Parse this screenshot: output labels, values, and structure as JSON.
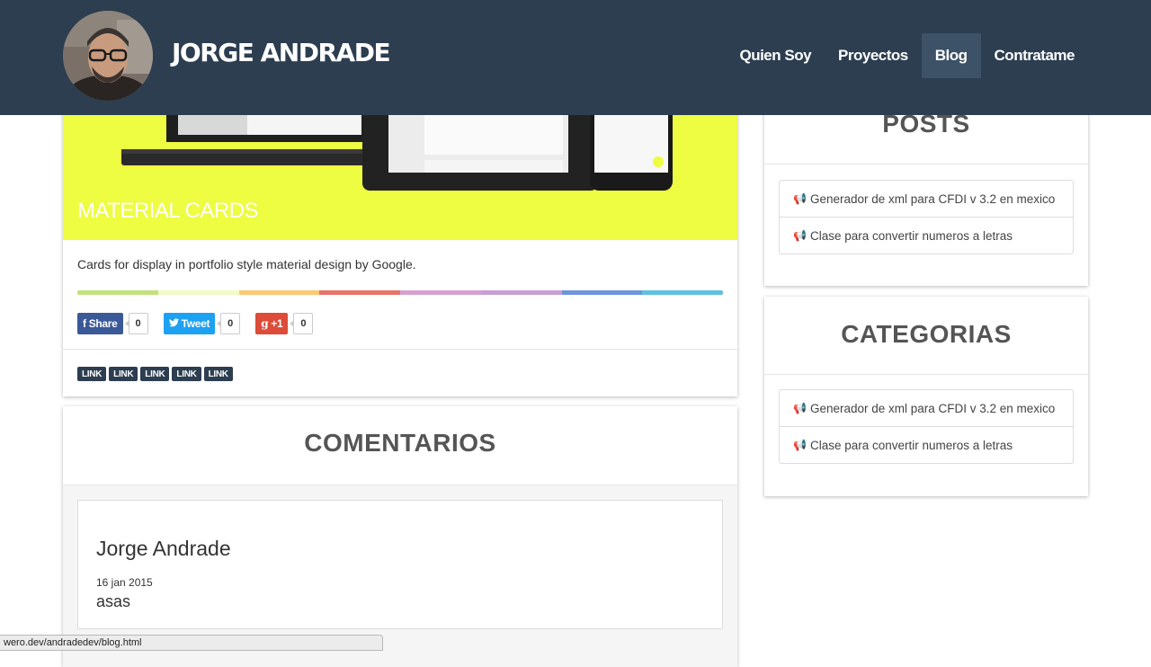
{
  "navbar": {
    "brand": "Jorge Andrade",
    "nav": [
      {
        "label": "Quien Soy",
        "active": false
      },
      {
        "label": "Proyectos",
        "active": false
      },
      {
        "label": "Blog",
        "active": true
      },
      {
        "label": "Contratame",
        "active": false
      }
    ]
  },
  "post": {
    "title": "MATERIAL CARDS",
    "description": "Cards for display in portfolio style material design by Google.",
    "hero_color": "#eefc42",
    "color_bar": [
      "#c1e17d",
      "#f3fbc5",
      "#fcc873",
      "#e87469",
      "#d5a2cf",
      "#c79fd5",
      "#6e95dc",
      "#5fc0e3"
    ],
    "share": {
      "facebook": {
        "label": "Share",
        "count": "0",
        "color": "#3b5998"
      },
      "twitter": {
        "label": "Tweet",
        "count": "0",
        "color": "#1da1f2"
      },
      "gplus": {
        "label": "+1",
        "count": "0",
        "color": "#dd4b39"
      }
    },
    "tags": [
      "LINK",
      "LINK",
      "LINK",
      "LINK",
      "LINK"
    ]
  },
  "comments": {
    "title": "COMENTARIOS",
    "items": [
      {
        "author": "Jorge Andrade",
        "date": "16 jan 2015",
        "body": "asas"
      }
    ]
  },
  "sidebar": {
    "posts": {
      "title": "POSTS",
      "items": [
        "Generador de xml para CFDI v 3.2 en mexico",
        "Clase para convertir numeros a letras"
      ]
    },
    "categories": {
      "title": "CATEGORIAS",
      "items": [
        "Generador de xml para CFDI v 3.2 en mexico",
        "Clase para convertir numeros a letras"
      ]
    }
  },
  "statusbar": {
    "url": "wero.dev/andradedev/blog.html"
  },
  "colors": {
    "navbar": "#2c3e50",
    "nav_active": "#3d5266",
    "tag": "#2c3e50"
  }
}
